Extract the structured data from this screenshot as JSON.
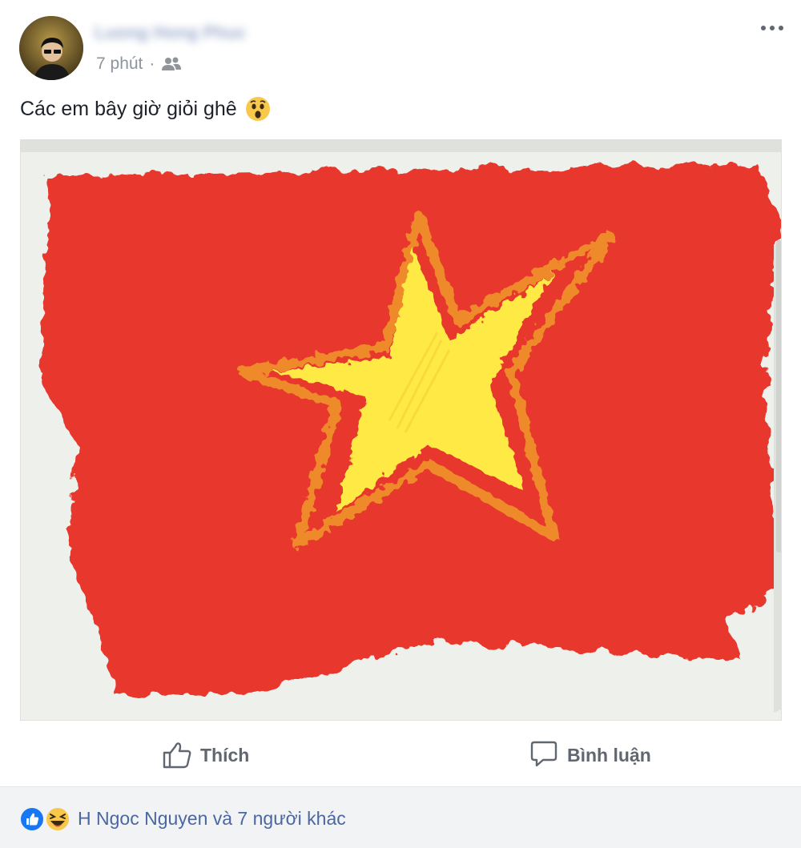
{
  "post": {
    "author_name": "Luong Hong Phuc",
    "timestamp": "7 phút",
    "separator": "·",
    "audience_icon": "friends-icon",
    "text": "Các em bây giờ giỏi ghê",
    "text_emoji": "wow-emoji"
  },
  "actions": {
    "like_label": "Thích",
    "comment_label": "Bình luận"
  },
  "reactions": {
    "summary": "H Ngoc Nguyen và 7 người khác",
    "icons": [
      "like-reaction-icon",
      "haha-reaction-icon"
    ]
  },
  "colors": {
    "link": "#4b67a1",
    "meta": "#8f949b",
    "action": "#606770",
    "like_blue": "#1877f2",
    "flag_red": "#e8392f",
    "star_yellow": "#ffe945",
    "star_outline": "#ef8a2c"
  }
}
